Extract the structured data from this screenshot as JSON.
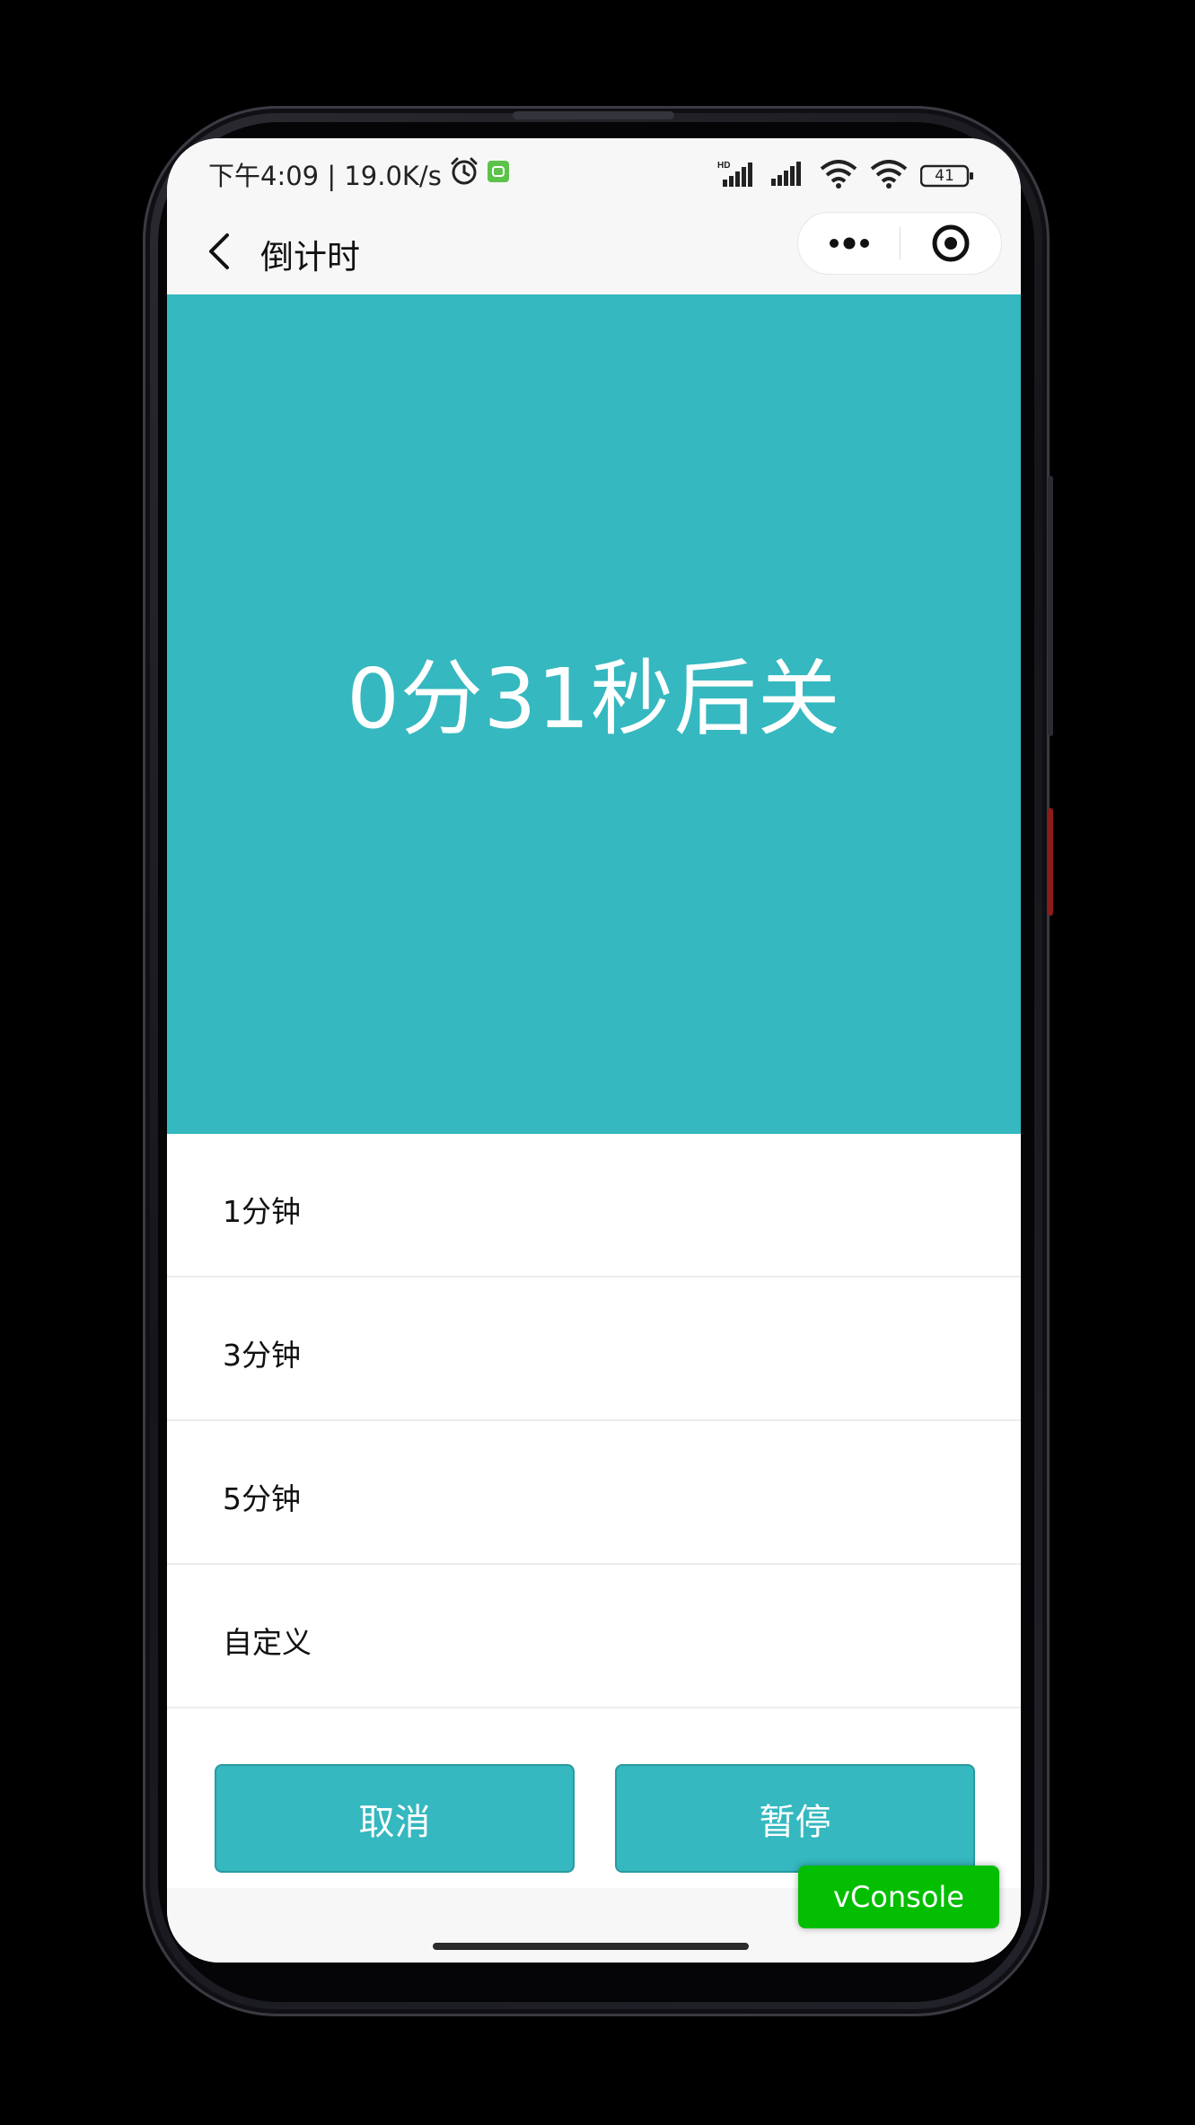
{
  "status_bar": {
    "time_speed": "下午4:09 | 19.0K/s",
    "battery_level": "41",
    "icons": [
      "alarm-icon",
      "app-notification-icon",
      "hd-signal-icon",
      "signal-icon",
      "wifi-icon",
      "wifi-icon",
      "battery-icon"
    ]
  },
  "nav": {
    "title": "倒计时",
    "back_icon": "chevron-left-icon",
    "more_icon": "more-dots-icon",
    "close_icon": "target-icon"
  },
  "timer": {
    "countdown_text": "0分31秒后关",
    "background_color": "#35b8bf"
  },
  "options": [
    {
      "label": "1分钟"
    },
    {
      "label": "3分钟"
    },
    {
      "label": "5分钟"
    },
    {
      "label": "自定义"
    }
  ],
  "buttons": {
    "cancel_label": "取消",
    "pause_label": "暂停",
    "color": "#35b8bf"
  },
  "vconsole": {
    "label": "vConsole",
    "color": "#04be02"
  }
}
